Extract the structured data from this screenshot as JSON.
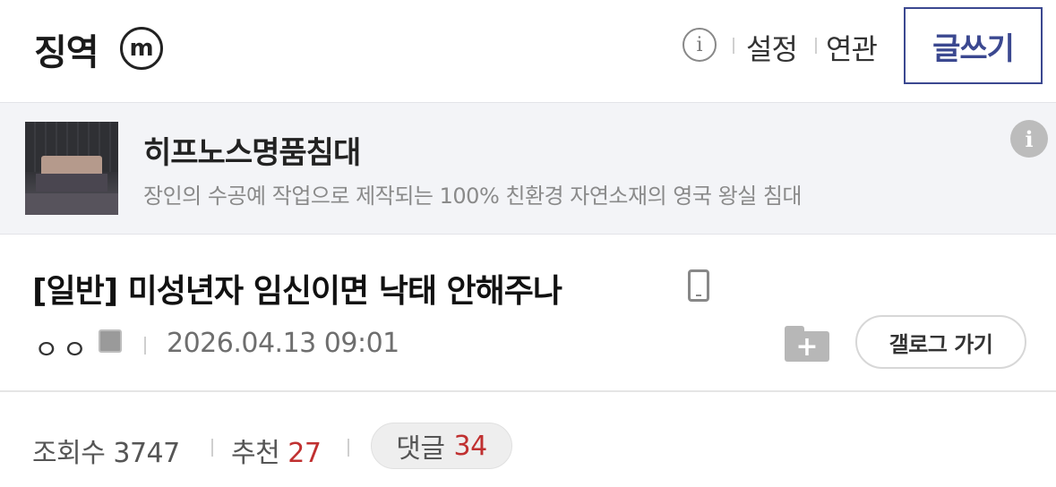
{
  "header": {
    "gallery_title": "징역",
    "badge_letter": "m",
    "info_icon": "info-circle-icon",
    "settings_label": "설정",
    "related_label": "연관",
    "write_label": "글쓰기"
  },
  "ad": {
    "title": "히프노스명품침대",
    "description": "장인의 수공예 작업으로 제작되는 100% 친환경 자연소재의 영국 왕실 침대",
    "info_icon": "info-icon"
  },
  "post": {
    "title": "[일반] 미성년자 임신이면 낙태 안해주나",
    "device_icon": "mobile-icon",
    "author": "ㅇㅇ",
    "author_icon": "user-icon",
    "date": "2026.04.13 09:01",
    "folder_icon": "folder-add-icon",
    "gallery_go_label": "갤로그 가기"
  },
  "stats": {
    "views_label": "조회수",
    "views": "3747",
    "recommend_label": "추천",
    "recommend": "27",
    "comments_label": "댓글",
    "comments": "34"
  },
  "colors": {
    "accent": "#3b4890",
    "highlight_red": "#c03030",
    "ad_background": "#f3f4f7"
  }
}
